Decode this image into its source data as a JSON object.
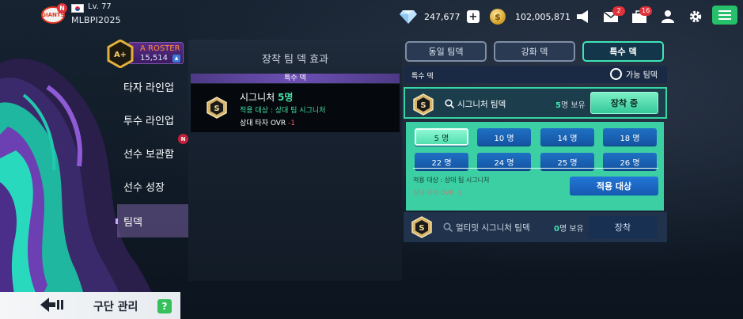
{
  "profile": {
    "team_logo_text": "GIANTS",
    "logo_badge": "N",
    "level": "Lv. 77",
    "username": "MLBPI2025"
  },
  "currency": {
    "gems": "247,677",
    "coins": "102,005,871"
  },
  "topbar": {
    "mail_badge": "2",
    "inbox_badge": "16"
  },
  "roster": {
    "grade": "A+",
    "title": "A ROSTER",
    "value": "15,514"
  },
  "nav": {
    "items": [
      {
        "label": "타자 라인업"
      },
      {
        "label": "투수 라인업"
      },
      {
        "label": "선수 보관함",
        "badge": "N"
      },
      {
        "label": "선수 성장"
      },
      {
        "label": "팀덱"
      }
    ]
  },
  "bottom": {
    "title": "구단 관리",
    "help": "?"
  },
  "equipped": {
    "title": "장착 팀 덱 효과",
    "section": "특수 덱",
    "badge": "S",
    "name": "시그니처",
    "count": "5명",
    "target": "적용 대상 : 상대 팀 시그니처",
    "effect_label": "상대 타자 OVR",
    "effect_value": "-1"
  },
  "tabs": [
    {
      "label": "동일 팀덱"
    },
    {
      "label": "강화 덱"
    },
    {
      "label": "특수 덱"
    }
  ],
  "special": {
    "header": "특수 덱",
    "available_label": "가능 팀덱",
    "signature": {
      "badge": "S",
      "name": "시그니처 팀덱",
      "owned_count": "5",
      "owned_suffix": "명 보유",
      "action": "장착 중"
    },
    "counts": [
      "5 명",
      "10 명",
      "14 명",
      "18 명",
      "22 명",
      "24 명",
      "25 명",
      "26 명"
    ],
    "selected_count": "5 명",
    "apply_target": "적용 대상 : 상대 팀 시그니처",
    "apply_effect": "상대 타자 OVR -1",
    "apply_button": "적용 대상",
    "ultimate": {
      "badge": "S",
      "name": "얼티밋 시그니처 팀덱",
      "owned_count": "0",
      "owned_suffix": "명 보유",
      "action": "장착"
    }
  },
  "colors": {
    "accent": "#3fe4b4",
    "panel_green": "#3dcfa4",
    "button_blue": "#1f70c4",
    "danger": "#ff5a5a",
    "purple": "#6d4fb3"
  }
}
